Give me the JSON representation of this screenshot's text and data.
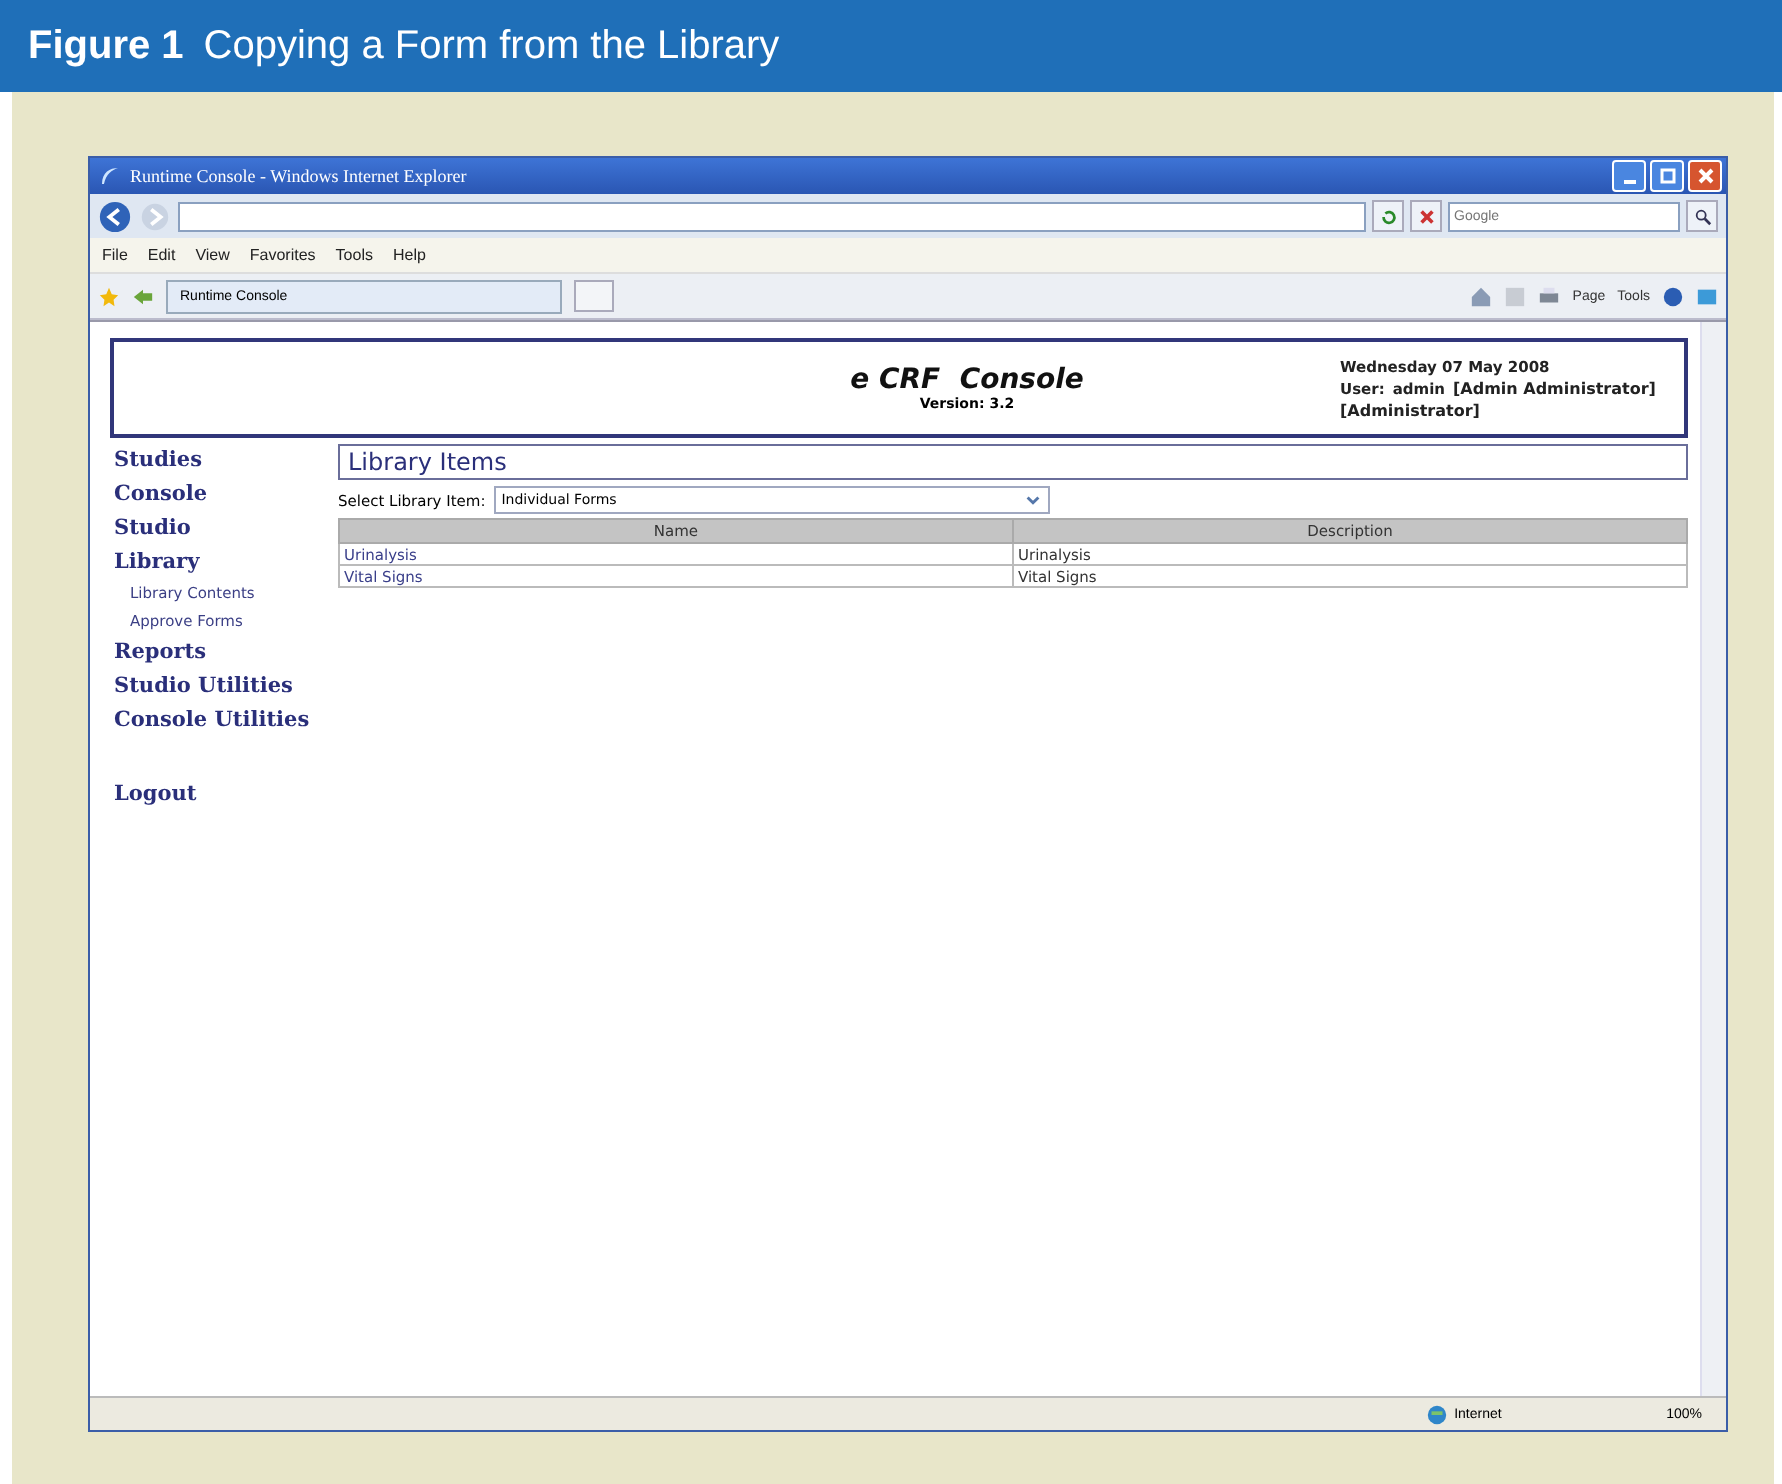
{
  "figure": {
    "label": "Figure 1",
    "caption": "Copying a Form from the Library"
  },
  "browser": {
    "title": "Runtime Console - Windows Internet Explorer",
    "search_placeholder": "Google",
    "menu": [
      "File",
      "Edit",
      "View",
      "Favorites",
      "Tools",
      "Help"
    ],
    "tab": "Runtime Console",
    "toolbar": [
      "Page",
      "Tools"
    ],
    "status": {
      "zone": "Internet",
      "zoom": "100%"
    }
  },
  "app_header": {
    "title": "e CRF  Console",
    "version": "Version: 3.2",
    "date": "Wednesday 07 May 2008",
    "user_label": "User:",
    "user": "admin",
    "user_name": "[Admin Administrator]",
    "role": "[Administrator]"
  },
  "nav": [
    {
      "label": "Studies"
    },
    {
      "label": "Console"
    },
    {
      "label": "Studio"
    },
    {
      "label": "Library",
      "children": [
        {
          "label": "Library Contents"
        },
        {
          "label": "Approve Forms"
        }
      ]
    },
    {
      "label": "Reports"
    },
    {
      "label": "Studio Utilities"
    },
    {
      "label": "Console Utilities"
    },
    {
      "label": "Logout",
      "kind": "logout"
    }
  ],
  "content": {
    "heading": "Library Items",
    "select_label": "Select Library Item:",
    "select_value": "Individual Forms",
    "table": {
      "columns": [
        "Name",
        "Description"
      ],
      "rows": [
        [
          "Urinalysis",
          "Urinalysis"
        ],
        [
          "Vital Signs",
          "Vital Signs"
        ]
      ]
    }
  }
}
